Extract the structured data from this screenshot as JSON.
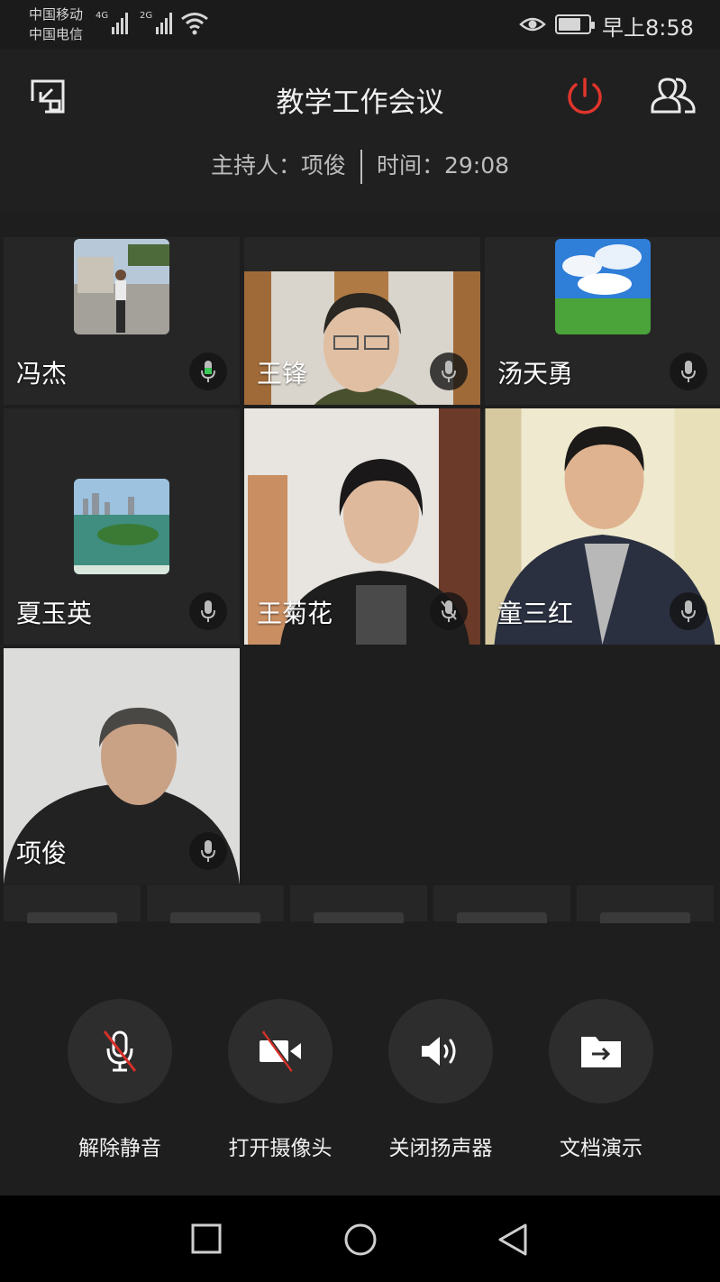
{
  "status_bar": {
    "carrier_1": "中国移动",
    "carrier_2": "中国电信",
    "network_1": "4G",
    "network_2": "2G",
    "time": "早上8:58",
    "icons": [
      "signal-icon",
      "wifi-icon",
      "eye-comfort-icon",
      "battery-icon"
    ]
  },
  "header": {
    "title": "教学工作会议",
    "host_label": "主持人：",
    "host_name": "项俊",
    "time_label": "时间：",
    "elapsed": "29:08",
    "icons": [
      "minimize-window-icon",
      "power-icon",
      "participants-icon"
    ],
    "power_color": "#e0352b"
  },
  "participants": [
    {
      "name": "冯杰",
      "mic": "active",
      "mic_color": "#3cc85a"
    },
    {
      "name": "王锋",
      "mic": "idle"
    },
    {
      "name": "汤天勇",
      "mic": "idle"
    },
    {
      "name": "夏玉英",
      "mic": "idle"
    },
    {
      "name": "王菊花",
      "mic": "muted"
    },
    {
      "name": "童三红",
      "mic": "idle"
    },
    {
      "name": "项俊",
      "mic": "idle"
    }
  ],
  "controls": [
    {
      "label": "解除静音",
      "icon": "mic-muted-icon"
    },
    {
      "label": "打开摄像头",
      "icon": "camera-off-icon"
    },
    {
      "label": "关闭扬声器",
      "icon": "speaker-icon"
    },
    {
      "label": "文档演示",
      "icon": "share-document-icon"
    }
  ],
  "nav_bar": {
    "icons": [
      "recents-icon",
      "home-icon",
      "back-icon"
    ]
  }
}
